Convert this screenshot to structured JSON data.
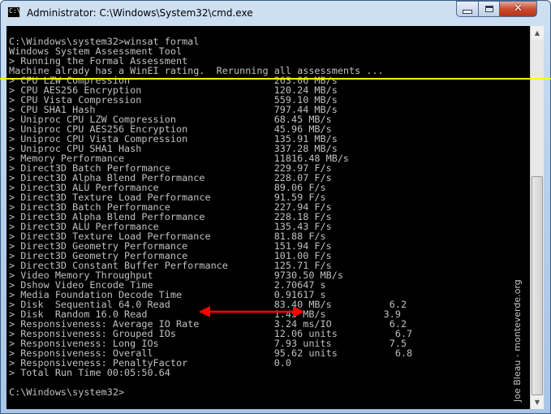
{
  "window": {
    "title": "Administrator: C:\\Windows\\System32\\cmd.exe",
    "icon_label": "C:\\"
  },
  "controls": {
    "close_glyph": "✕"
  },
  "console": {
    "lines": [
      "C:\\Windows\\system32>winsat formal",
      "Windows System Assessment Tool",
      "> Running the Formal Assessment",
      "Machine alrady has a WinEI rating.  Rerunning all assessments ...",
      "> CPU LZW Compression                         263.06 MB/s",
      "> CPU AES256 Encryption                       120.24 MB/s",
      "> CPU Vista Compression                       559.10 MB/s",
      "> CPU SHA1 Hash                               797.44 MB/s",
      "> Uniproc CPU LZW Compression                 68.45 MB/s",
      "> Uniproc CPU AES256 Encryption               45.96 MB/s",
      "> Uniproc CPU Vista Compression               135.91 MB/s",
      "> Uniproc CPU SHA1 Hash                       337.28 MB/s",
      "> Memory Performance                          11816.48 MB/s",
      "> Direct3D Batch Performance                  229.97 F/s",
      "> Direct3D Alpha Blend Performance            228.07 F/s",
      "> Direct3D ALU Performance                    89.06 F/s",
      "> Direct3D Texture Load Performance           91.59 F/s",
      "> Direct3D Batch Performance                  227.94 F/s",
      "> Direct3D Alpha Blend Performance            228.18 F/s",
      "> Direct3D ALU Performance                    135.43 F/s",
      "> Direct3D Texture Load Performance           81.88 F/s",
      "> Direct3D Geometry Performance               151.94 F/s",
      "> Direct3D Geometry Performance               101.00 F/s",
      "> Direct3D Constant Buffer Performance        125.71 F/s",
      "> Video Memory Throughput                     9730.50 MB/s",
      "> Dshow Video Encode Time                     2.70647 s",
      "> Media Foundation Decode Time                0.91617 s",
      "> Disk  Sequential 64.0 Read                  83.40 MB/s          6.2",
      "> Disk  Random 16.0 Read                      1.45 MB/s          3.9",
      "> Responsiveness: Average IO Rate             3.24 ms/IO          6.2",
      "> Responsiveness: Grouped IOs                 12.06 units          6.7",
      "> Responsiveness: Long IOs                    7.93 units          7.5",
      "> Responsiveness: Overall                     95.62 units          6.8",
      "> Responsiveness: PenaltyFactor               0.0",
      "> Total Run Time 00:05:50.64",
      "",
      "C:\\Windows\\system32>"
    ]
  },
  "scrollbar": {
    "up_glyph": "▲",
    "down_glyph": "▼"
  },
  "annotations": {
    "watermark": "Joe Bleau - monteverde.org",
    "highlight_color": "#ffff00",
    "arrow_color": "#ff0000"
  }
}
